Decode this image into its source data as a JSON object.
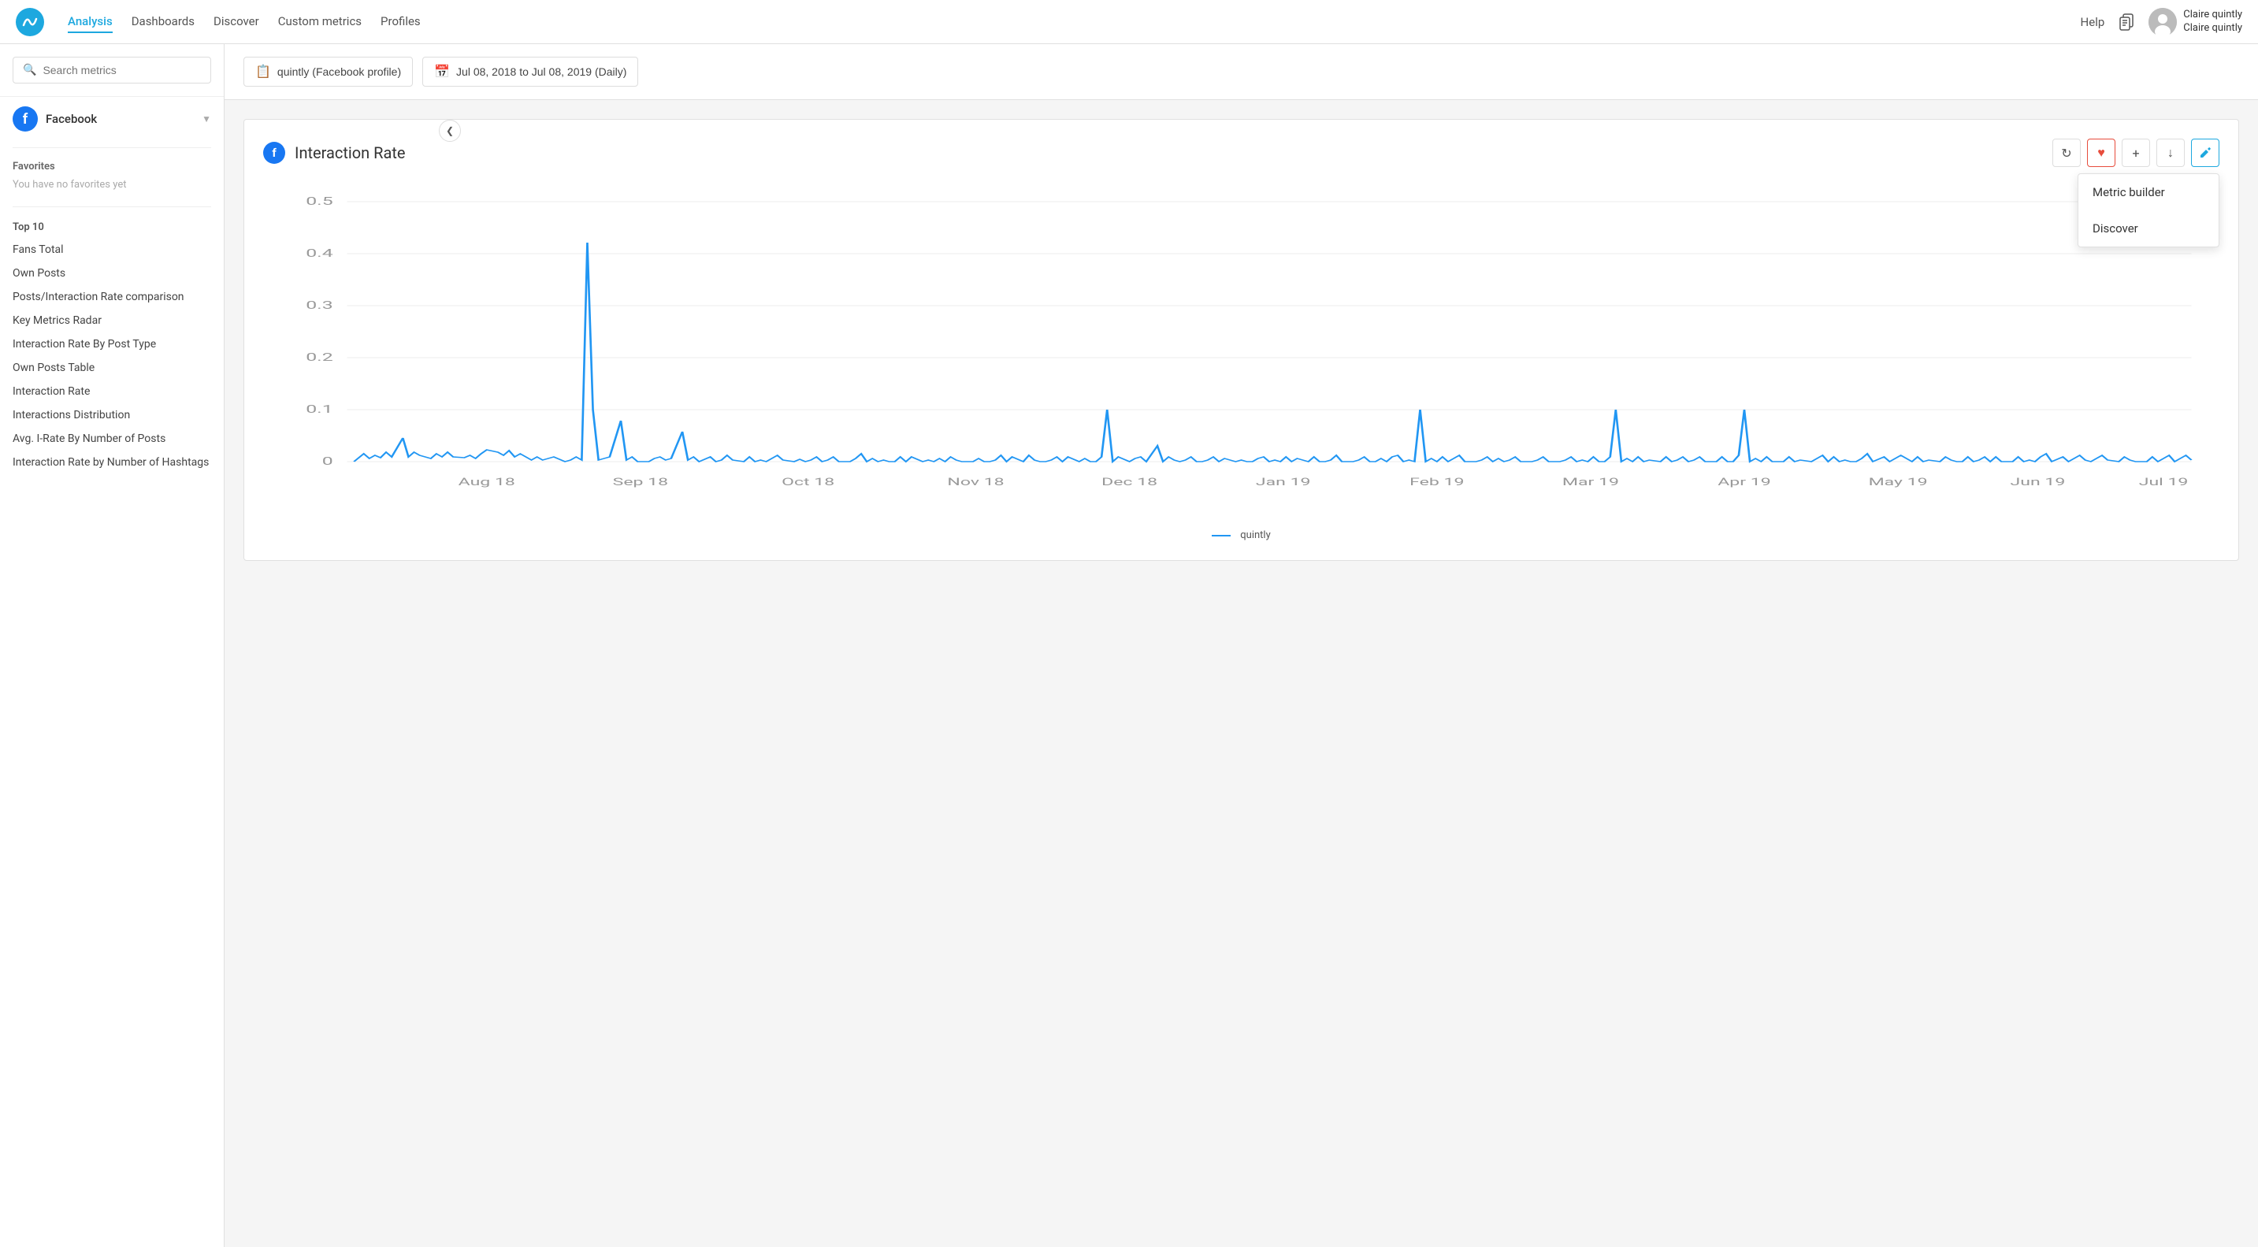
{
  "topnav": {
    "links": [
      {
        "label": "Analysis",
        "active": true
      },
      {
        "label": "Dashboards",
        "active": false
      },
      {
        "label": "Discover",
        "active": false
      },
      {
        "label": "Custom metrics",
        "active": false
      },
      {
        "label": "Profiles",
        "active": false
      }
    ],
    "help_label": "Help",
    "user": {
      "name_line1": "Claire quintly",
      "name_line2": "Claire quintly"
    }
  },
  "sidebar": {
    "search_placeholder": "Search metrics",
    "platform": {
      "label": "Facebook"
    },
    "favorites_label": "Favorites",
    "favorites_empty": "You have no favorites yet",
    "top10_label": "Top 10",
    "items": [
      {
        "label": "Fans Total"
      },
      {
        "label": "Own Posts"
      },
      {
        "label": "Posts/Interaction Rate comparison"
      },
      {
        "label": "Key Metrics Radar"
      },
      {
        "label": "Interaction Rate By Post Type"
      },
      {
        "label": "Own Posts Table"
      },
      {
        "label": "Interaction Rate"
      },
      {
        "label": "Interactions Distribution"
      },
      {
        "label": "Avg. I-Rate By Number of Posts"
      },
      {
        "label": "Interaction Rate by Number of Hashtags"
      }
    ]
  },
  "toolbar": {
    "profile_label": "quintly (Facebook profile)",
    "date_label": "Jul 08, 2018 to Jul 08, 2019 (Daily)"
  },
  "chart": {
    "title": "Interaction Rate",
    "dropdown": {
      "metric_builder": "Metric builder",
      "discover": "Discover"
    },
    "legend_label": "quintly",
    "y_labels": [
      "0.5",
      "0.4",
      "0.3",
      "0.2",
      "0.1",
      "0"
    ],
    "x_labels": [
      "Aug 18",
      "Sep 18",
      "Oct 18",
      "Nov 18",
      "Dec 18",
      "Jan 19",
      "Feb 19",
      "Mar 19",
      "Apr 19",
      "May 19",
      "Jun 19",
      "Jul 19"
    ]
  }
}
